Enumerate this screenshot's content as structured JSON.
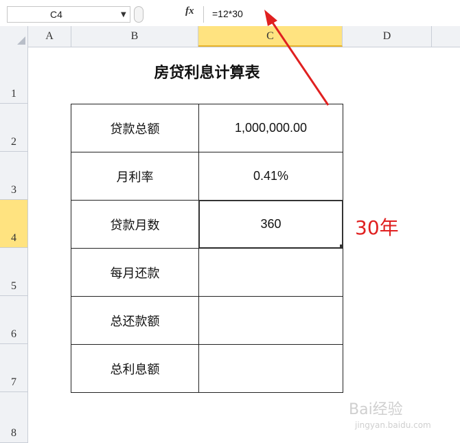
{
  "formula_bar": {
    "name_box": "C4",
    "fx_label": "fx",
    "formula": "=12*30"
  },
  "columns": [
    "A",
    "B",
    "C",
    "D"
  ],
  "rows": [
    "1",
    "2",
    "3",
    "4",
    "5",
    "6",
    "7",
    "8"
  ],
  "selected_column": "C",
  "selected_row": "4",
  "sheet": {
    "title": "房贷利息计算表",
    "table": [
      {
        "label": "贷款总额",
        "value": "1,000,000.00"
      },
      {
        "label": "月利率",
        "value": "0.41%"
      },
      {
        "label": "贷款月数",
        "value": "360"
      },
      {
        "label": "每月还款",
        "value": ""
      },
      {
        "label": "总还款额",
        "value": ""
      },
      {
        "label": "总利息额",
        "value": ""
      }
    ]
  },
  "annotation": {
    "text": "30年",
    "color": "#e02020"
  },
  "watermark": {
    "text": "Bai经验",
    "sub": "jingyan.baidu.com"
  }
}
